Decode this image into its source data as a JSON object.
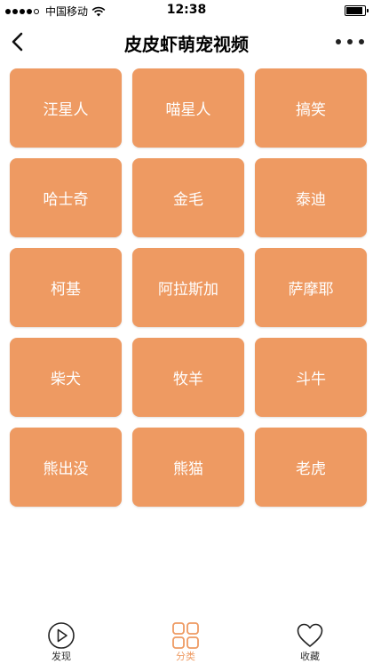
{
  "status_bar": {
    "carrier": "中国移动",
    "time": "12:38",
    "signal_bars": 5,
    "signal_filled": 4,
    "battery_level": 1.0
  },
  "nav": {
    "title": "皮皮虾萌宠视频",
    "back_icon": "chevron-left-icon",
    "more_icon": "more-dots-icon"
  },
  "categories": [
    "汪星人",
    "喵星人",
    "搞笑",
    "哈士奇",
    "金毛",
    "泰迪",
    "柯基",
    "阿拉斯加",
    "萨摩耶",
    "柴犬",
    "牧羊",
    "斗牛",
    "熊出没",
    "熊猫",
    "老虎"
  ],
  "tabs": [
    {
      "label": "发现",
      "icon": "play-circle-icon",
      "active": false
    },
    {
      "label": "分类",
      "icon": "grid-icon",
      "active": true
    },
    {
      "label": "收藏",
      "icon": "heart-icon",
      "active": false
    }
  ],
  "colors": {
    "accent": "#ee9a62",
    "button_text": "#ffffff",
    "tab_inactive": "#333333"
  }
}
